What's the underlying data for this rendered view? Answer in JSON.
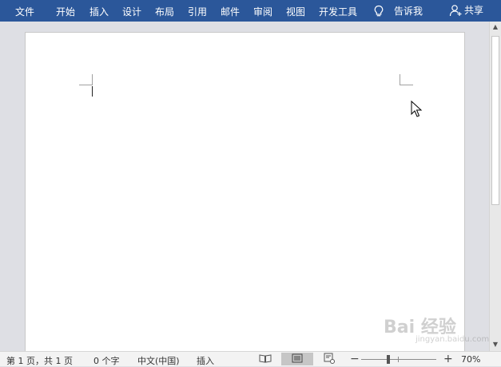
{
  "ribbon": {
    "tabs": [
      "文件",
      "开始",
      "插入",
      "设计",
      "布局",
      "引用",
      "邮件",
      "审阅",
      "视图",
      "开发工具"
    ],
    "tell_me": "告诉我",
    "share": "共享",
    "background": "#2b579a"
  },
  "status": {
    "page": "第 1 页，共 1 页",
    "words": "0 个字",
    "language": "中文(中国)",
    "mode": "插入",
    "zoom": "70%",
    "zoom_level": 0.7
  },
  "watermark": {
    "text": "Bai 经验",
    "sub": "jingyan.baidu.com"
  },
  "icons": {
    "lightbulb": "lightbulb-icon",
    "person": "person-icon",
    "read_mode": "read-mode-icon",
    "print_layout": "print-layout-icon",
    "web_layout": "web-layout-icon",
    "cursor": "mouse-pointer-icon"
  }
}
